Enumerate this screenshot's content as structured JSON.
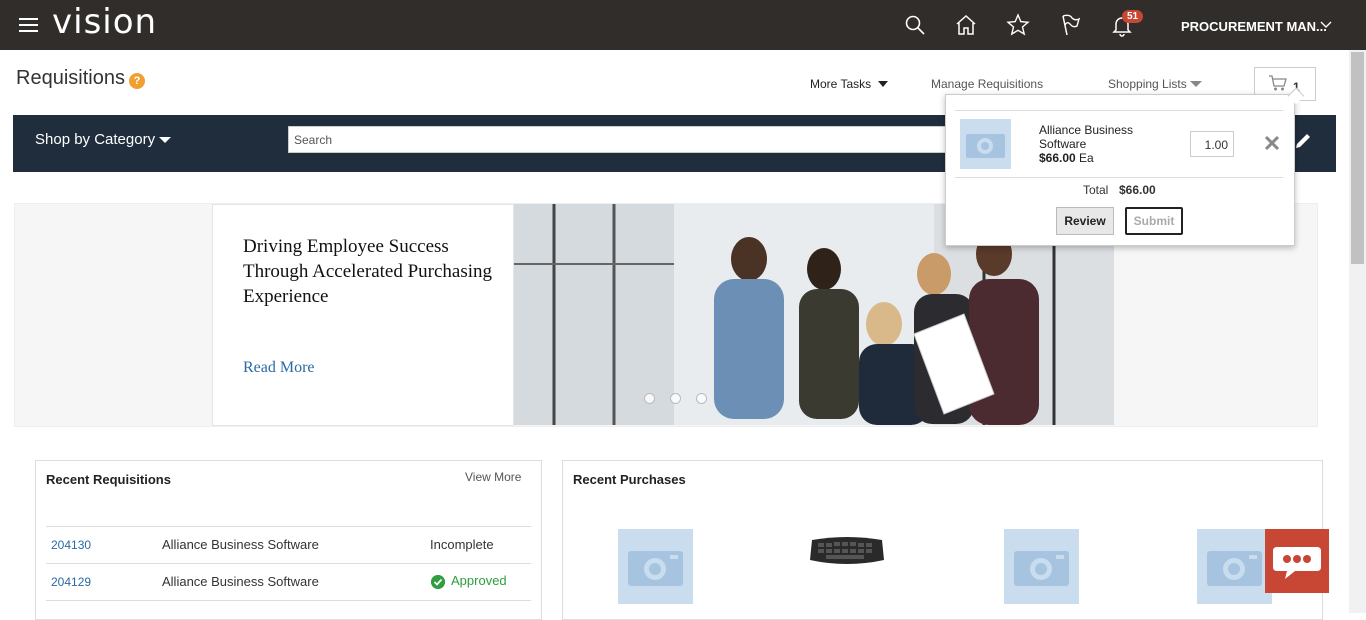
{
  "header": {
    "brand": "vision",
    "notification_count": "51",
    "user_role": "PROCUREMENT MAN...",
    "icons": [
      "search-icon",
      "home-icon",
      "star-icon",
      "flag-icon",
      "bell-icon"
    ]
  },
  "page": {
    "title": "Requisitions",
    "help": "?"
  },
  "actions": {
    "more_tasks": "More Tasks",
    "manage_requisitions": "Manage Requisitions",
    "shopping_lists": "Shopping Lists",
    "cart_count": "1"
  },
  "catalog": {
    "shop_by_category": "Shop by Category",
    "search_placeholder": "Search"
  },
  "hero": {
    "title": "Driving Employee Success Through Accelerated Purchasing Experience",
    "link": "Read More"
  },
  "recent_requisitions": {
    "title": "Recent Requisitions",
    "view_more": "View More",
    "rows": [
      {
        "id": "204130",
        "description": "Alliance Business Software",
        "status": "Incomplete"
      },
      {
        "id": "204129",
        "description": "Alliance Business Software",
        "status": "Approved"
      }
    ]
  },
  "recent_purchases": {
    "title": "Recent Purchases"
  },
  "cart_popup": {
    "item_name": "Alliance Business Software",
    "item_price": "$66.00",
    "item_uom": "Ea",
    "quantity": "1.00",
    "total_label": "Total",
    "total_value": "$66.00",
    "review": "Review",
    "submit": "Submit"
  },
  "colors": {
    "topbar": "#312d2a",
    "category_bar": "#1f2d3d",
    "accent_red": "#c74634",
    "link_blue": "#2a6aa5",
    "approved_green": "#2e9e3e"
  }
}
